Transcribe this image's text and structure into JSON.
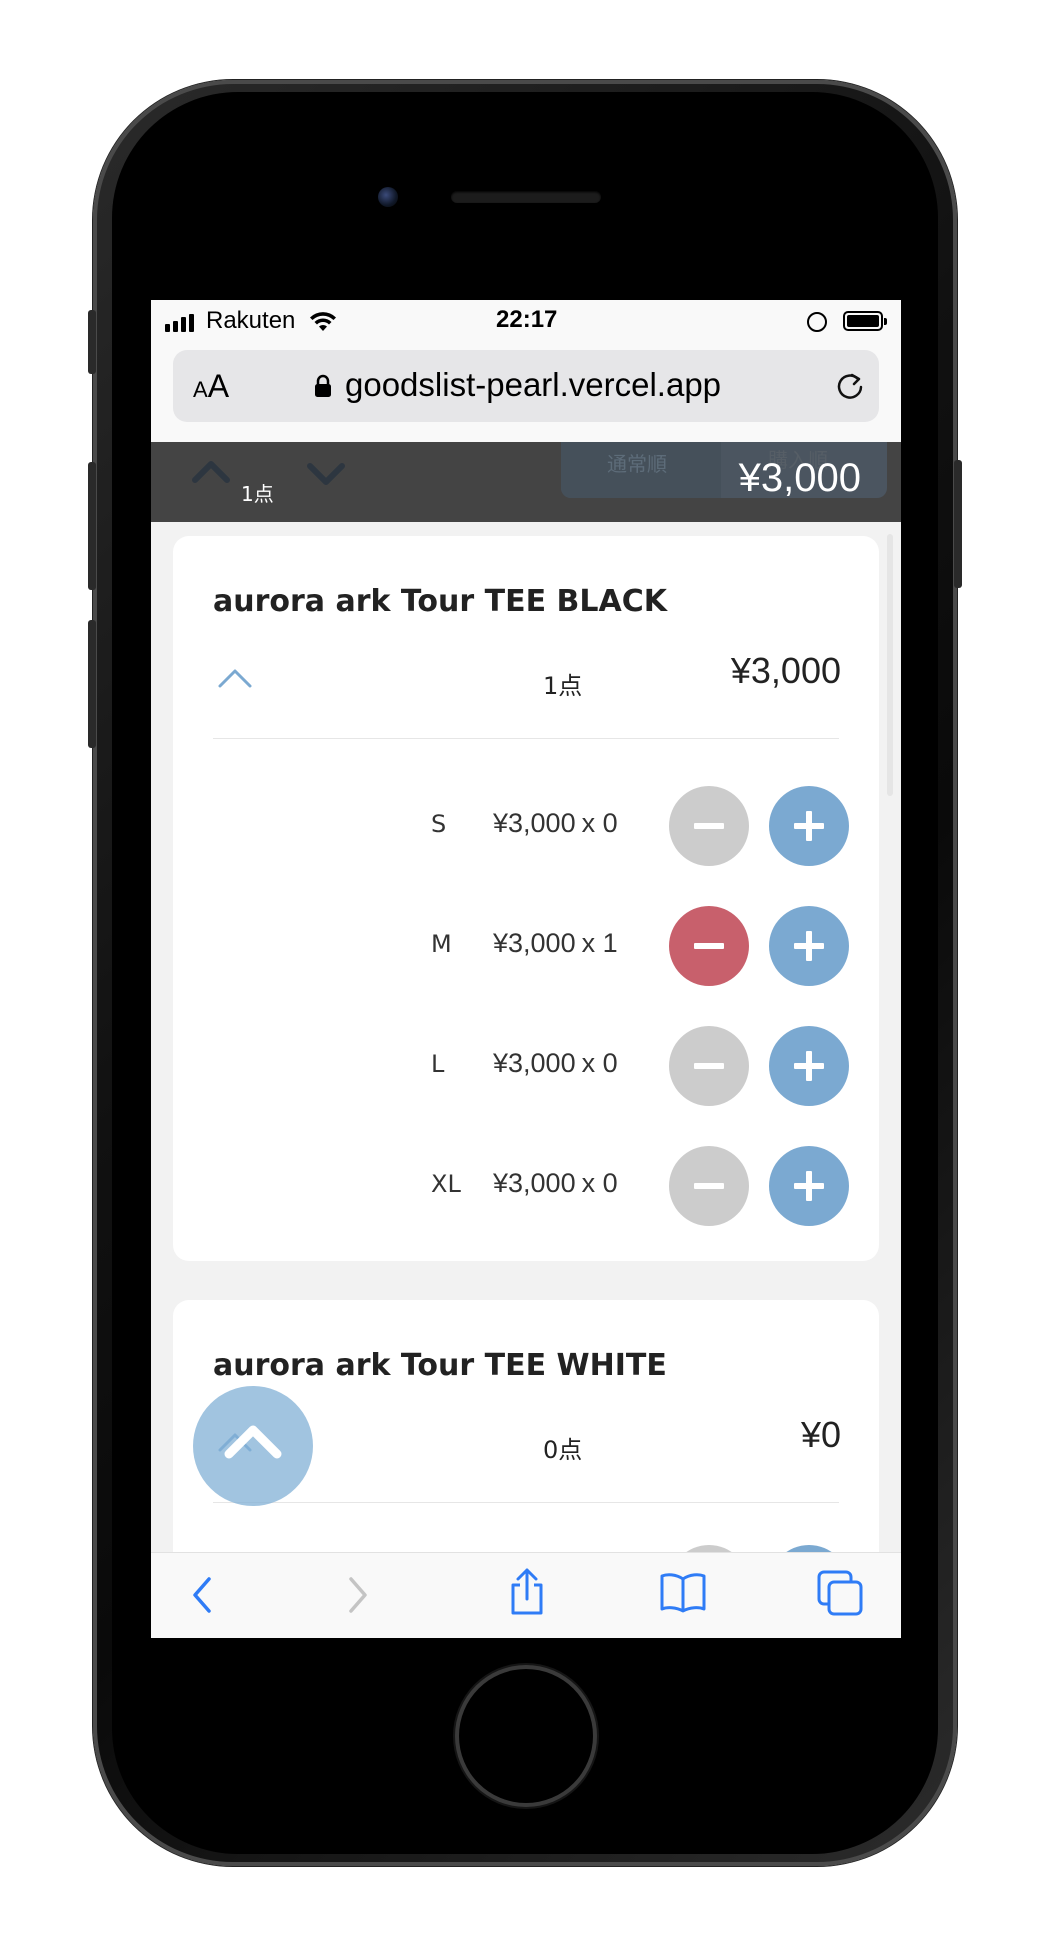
{
  "status_bar": {
    "carrier": "Rakuten",
    "time": "22:17"
  },
  "browser": {
    "aa_label_small": "A",
    "aa_label_big": "A",
    "url": "goodslist-pearl.vercel.app"
  },
  "sticky_header": {
    "count": "1点",
    "sort_normal": "通常順",
    "sort_purchase": "購入順",
    "total": "¥3,000"
  },
  "products": [
    {
      "name": "aurora ark Tour TEE BLACK",
      "count": "1点",
      "price": "¥3,000",
      "variants": [
        {
          "size": "S",
          "unit_price": "¥3,000",
          "qty_label": "x 0",
          "qty": 0
        },
        {
          "size": "M",
          "unit_price": "¥3,000",
          "qty_label": "x 1",
          "qty": 1
        },
        {
          "size": "L",
          "unit_price": "¥3,000",
          "qty_label": "x 0",
          "qty": 0
        },
        {
          "size": "XL",
          "unit_price": "¥3,000",
          "qty_label": "x 0",
          "qty": 0
        }
      ]
    },
    {
      "name": "aurora ark Tour TEE WHITE",
      "count": "0点",
      "price": "¥0"
    }
  ],
  "colors": {
    "accent_blue": "#7ba9d1",
    "minus_active": "#c8606c",
    "minus_disabled": "#cccccc",
    "header_bg": "#444444",
    "ios_blue": "#2f7cf6"
  }
}
